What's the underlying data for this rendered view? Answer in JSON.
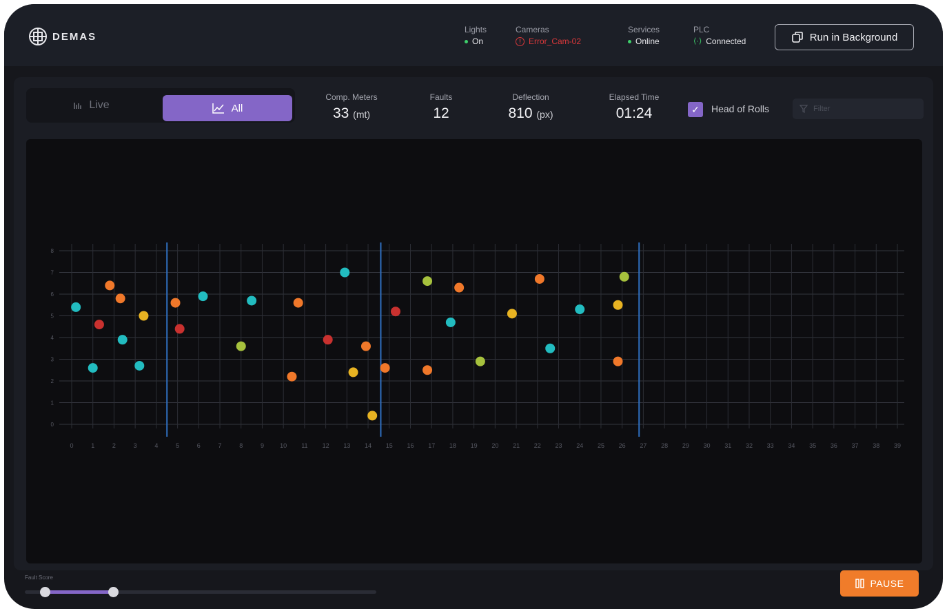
{
  "brand": {
    "logo_text": "DEMAS"
  },
  "status": {
    "lights": {
      "label": "Lights",
      "value": "On"
    },
    "cameras": {
      "label": "Cameras",
      "value": "Error_Cam-02"
    },
    "services": {
      "label": "Services",
      "value": "Online"
    },
    "plc": {
      "label": "PLC",
      "value": "Connected"
    }
  },
  "header": {
    "run_background_label": "Run in Background"
  },
  "view_toggle": {
    "live_label": "Live",
    "all_label": "All",
    "active": "All"
  },
  "metrics": {
    "comp_meters": {
      "label": "Comp. Meters",
      "value": "33",
      "unit": "(mt)"
    },
    "faults": {
      "label": "Faults",
      "value": "12"
    },
    "deflection": {
      "label": "Deflection",
      "value": "810",
      "unit": "(px)"
    },
    "elapsed": {
      "label": "Elapsed Time",
      "value": "01:24"
    }
  },
  "head_of_rolls": {
    "label": "Head of Rolls",
    "checked": true
  },
  "filter": {
    "placeholder": "Filter"
  },
  "footer": {
    "fault_score_label": "Fault Score",
    "pause_label": "PAUSE"
  },
  "colors": {
    "accent": "#8466c7",
    "pause": "#f07c2a",
    "ok": "#3ecf6b",
    "error": "#d9383a"
  },
  "chart_data": {
    "type": "scatter",
    "xlim": [
      0,
      39
    ],
    "ylim": [
      0,
      8
    ],
    "x_ticks": [
      0,
      1,
      2,
      3,
      4,
      5,
      6,
      7,
      8,
      9,
      10,
      11,
      12,
      13,
      14,
      15,
      16,
      17,
      18,
      19,
      20,
      21,
      22,
      23,
      24,
      25,
      26,
      27,
      28,
      29,
      30,
      31,
      32,
      33,
      34,
      35,
      36,
      37,
      38,
      39
    ],
    "y_ticks": [
      0,
      1,
      2,
      3,
      4,
      5,
      6,
      7,
      8
    ],
    "grid": true,
    "roll_markers_x": [
      4.5,
      14.6,
      26.8
    ],
    "points": [
      {
        "x": 0.2,
        "y": 5.4,
        "color": "#22bcc0"
      },
      {
        "x": 1.0,
        "y": 2.6,
        "color": "#22bcc0"
      },
      {
        "x": 1.3,
        "y": 4.6,
        "color": "#c9312f"
      },
      {
        "x": 1.8,
        "y": 6.4,
        "color": "#f0782a"
      },
      {
        "x": 2.3,
        "y": 5.8,
        "color": "#f0782a"
      },
      {
        "x": 2.4,
        "y": 3.9,
        "color": "#22bcc0"
      },
      {
        "x": 3.2,
        "y": 2.7,
        "color": "#22bcc0"
      },
      {
        "x": 3.4,
        "y": 5.0,
        "color": "#e8b322"
      },
      {
        "x": 4.9,
        "y": 5.6,
        "color": "#f0782a"
      },
      {
        "x": 5.1,
        "y": 4.4,
        "color": "#c9312f"
      },
      {
        "x": 6.2,
        "y": 5.9,
        "color": "#22bcc0"
      },
      {
        "x": 8.0,
        "y": 3.6,
        "color": "#a6c13d"
      },
      {
        "x": 8.5,
        "y": 5.7,
        "color": "#22bcc0"
      },
      {
        "x": 10.4,
        "y": 2.2,
        "color": "#f0782a"
      },
      {
        "x": 10.7,
        "y": 5.6,
        "color": "#f0782a"
      },
      {
        "x": 12.1,
        "y": 3.9,
        "color": "#c9312f"
      },
      {
        "x": 12.9,
        "y": 7.0,
        "color": "#22bcc0"
      },
      {
        "x": 13.3,
        "y": 2.4,
        "color": "#e8b322"
      },
      {
        "x": 13.9,
        "y": 3.6,
        "color": "#f0782a"
      },
      {
        "x": 14.2,
        "y": 0.4,
        "color": "#e8b322"
      },
      {
        "x": 14.8,
        "y": 2.6,
        "color": "#f0782a"
      },
      {
        "x": 15.3,
        "y": 5.2,
        "color": "#c9312f"
      },
      {
        "x": 16.8,
        "y": 2.5,
        "color": "#f0782a"
      },
      {
        "x": 16.8,
        "y": 6.6,
        "color": "#a6c13d"
      },
      {
        "x": 17.9,
        "y": 4.7,
        "color": "#22bcc0"
      },
      {
        "x": 18.3,
        "y": 6.3,
        "color": "#f0782a"
      },
      {
        "x": 19.3,
        "y": 2.9,
        "color": "#a6c13d"
      },
      {
        "x": 20.8,
        "y": 5.1,
        "color": "#e8b322"
      },
      {
        "x": 22.1,
        "y": 6.7,
        "color": "#f0782a"
      },
      {
        "x": 22.6,
        "y": 3.5,
        "color": "#22bcc0"
      },
      {
        "x": 24.0,
        "y": 5.3,
        "color": "#22bcc0"
      },
      {
        "x": 25.8,
        "y": 5.5,
        "color": "#e8b322"
      },
      {
        "x": 25.8,
        "y": 2.9,
        "color": "#f0782a"
      },
      {
        "x": 26.1,
        "y": 6.8,
        "color": "#a6c13d"
      }
    ]
  }
}
